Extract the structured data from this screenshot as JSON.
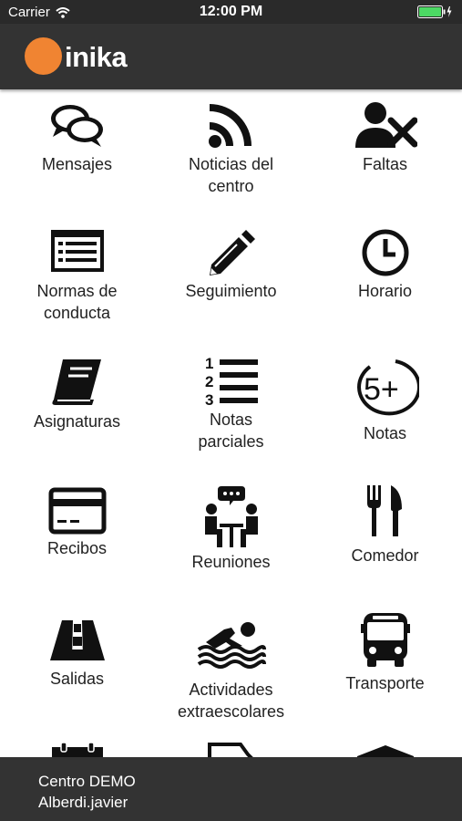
{
  "status_bar": {
    "carrier": "Carrier",
    "time": "12:00 PM"
  },
  "header": {
    "logo_text": "inika",
    "logo_color": "#f08432"
  },
  "menu": [
    {
      "label": "Mensajes",
      "icon": "chat-bubbles-icon"
    },
    {
      "label": "Noticias del\ncentro",
      "icon": "rss-feed-icon"
    },
    {
      "label": "Faltas",
      "icon": "user-absence-icon"
    },
    {
      "label": "Normas de\nconducta",
      "icon": "rules-list-icon"
    },
    {
      "label": "Seguimiento",
      "icon": "pencil-icon"
    },
    {
      "label": "Horario",
      "icon": "clock-icon"
    },
    {
      "label": "Asignaturas",
      "icon": "book-icon"
    },
    {
      "label": "Notas\nparciales",
      "icon": "numbered-list-icon"
    },
    {
      "label": "Notas",
      "icon": "grade-five-plus-icon"
    },
    {
      "label": "Recibos",
      "icon": "credit-card-icon"
    },
    {
      "label": "Reuniones",
      "icon": "meeting-icon"
    },
    {
      "label": "Comedor",
      "icon": "cutlery-icon"
    },
    {
      "label": "Salidas",
      "icon": "road-icon"
    },
    {
      "label": "Actividades\nextraescolares",
      "icon": "swimmer-icon"
    },
    {
      "label": "Transporte",
      "icon": "bus-icon"
    }
  ],
  "footer": {
    "center_name": "Centro DEMO",
    "username": "Alberdi.javier"
  }
}
